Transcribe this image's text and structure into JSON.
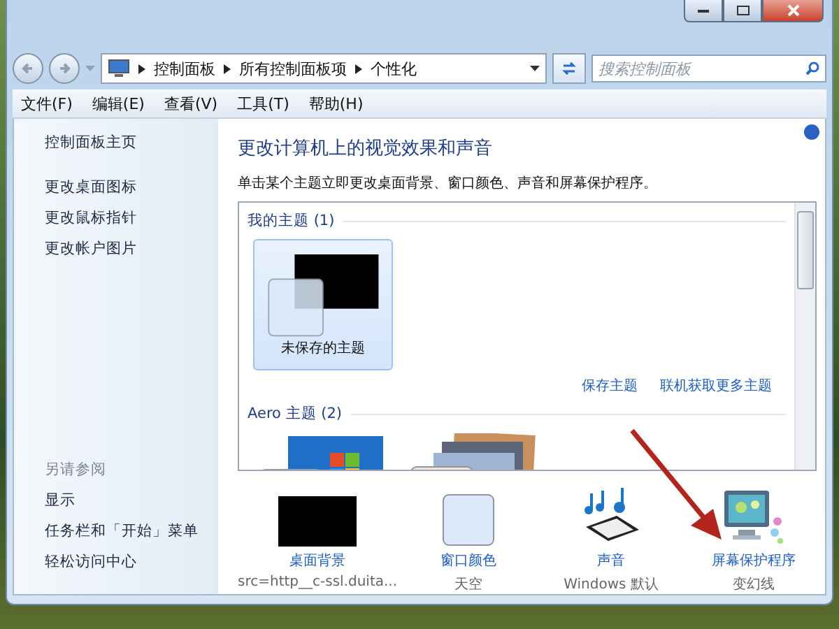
{
  "address": {
    "path": [
      "控制面板",
      "所有控制面板项",
      "个性化"
    ]
  },
  "search": {
    "placeholder": "搜索控制面板"
  },
  "menu": [
    "文件(F)",
    "编辑(E)",
    "查看(V)",
    "工具(T)",
    "帮助(H)"
  ],
  "sidebar": {
    "home": "控制面板主页",
    "tasks": [
      "更改桌面图标",
      "更改鼠标指针",
      "更改帐户图片"
    ],
    "see_also": {
      "heading": "另请参阅",
      "links": [
        "显示",
        "任务栏和「开始」菜单",
        "轻松访问中心"
      ]
    }
  },
  "content": {
    "title": "更改计算机上的视觉效果和声音",
    "description": "单击某个主题立即更改桌面背景、窗口颜色、声音和屏幕保护程序。"
  },
  "themes": [
    {
      "title": "我的主题 (1)",
      "items": [
        {
          "kind": "custom",
          "label": "未保存的主题",
          "selected": true
        }
      ],
      "links": [
        "保存主题",
        "联机获取更多主题"
      ]
    },
    {
      "title": "Aero 主题 (2)",
      "items": [
        {
          "kind": "windows",
          "selected": false
        },
        {
          "kind": "landscape",
          "selected": false
        }
      ]
    }
  ],
  "settings": [
    {
      "kind": "background",
      "label": "桌面背景",
      "value": "src=http__c-ssl.duita..."
    },
    {
      "kind": "color",
      "label": "窗口颜色",
      "value": "天空"
    },
    {
      "kind": "sound",
      "label": "声音",
      "value": "Windows 默认"
    },
    {
      "kind": "screensaver",
      "label": "屏幕保护程序",
      "value": "变幻线"
    }
  ]
}
